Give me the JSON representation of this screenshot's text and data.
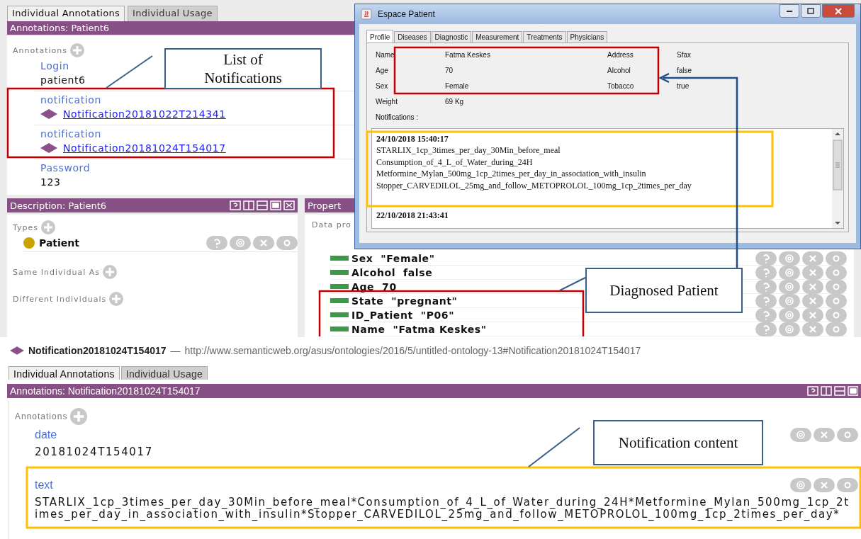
{
  "patient_annotations_panel": {
    "tabs": [
      {
        "label": "Individual Annotations",
        "selected": true
      },
      {
        "label": "Individual Usage",
        "selected": false
      }
    ],
    "header": "Annotations: Patient6",
    "section_label": "Annotations",
    "annotations": [
      {
        "property": "Login",
        "value": "patient6",
        "kind": "literal"
      },
      {
        "property": "notification",
        "value": "Notification20181022T214341",
        "kind": "individual"
      },
      {
        "property": "notification",
        "value": "Notification20181024T154017",
        "kind": "individual"
      },
      {
        "property": "Password",
        "value": "123",
        "kind": "literal"
      }
    ]
  },
  "description_panel": {
    "header": "Description: Patient6",
    "types_label": "Types",
    "types": [
      {
        "name": "Patient"
      }
    ],
    "sections": [
      "Same Individual As",
      "Different Individuals"
    ]
  },
  "property_panel": {
    "header": "Propert",
    "section_label": "Data pro",
    "assertions": [
      {
        "property": "Sex",
        "value": "\"Female\""
      },
      {
        "property": "Alcohol",
        "value": "false"
      },
      {
        "property": "Age",
        "value": "70"
      },
      {
        "property": "State",
        "value": "\"pregnant\""
      },
      {
        "property": "ID_Patient",
        "value": "\"P06\""
      },
      {
        "property": "Name",
        "value": "\"Fatma Keskes\""
      }
    ]
  },
  "patient_window": {
    "title": "Espace Patient",
    "tabs": [
      {
        "label": "Profile",
        "selected": true
      },
      {
        "label": "Diseases",
        "selected": false
      },
      {
        "label": "Diagnostic",
        "selected": false
      },
      {
        "label": "Measurement",
        "selected": false
      },
      {
        "label": "Treatments",
        "selected": false
      },
      {
        "label": "Physicians",
        "selected": false
      }
    ],
    "fields": [
      {
        "label": "Name",
        "value": "Fatma Keskes"
      },
      {
        "label": "Address",
        "value": "Sfax"
      },
      {
        "label": "Age",
        "value": "70"
      },
      {
        "label": "Alcohol",
        "value": "false"
      },
      {
        "label": "Sex",
        "value": "Female"
      },
      {
        "label": "Tobacco",
        "value": "true"
      },
      {
        "label": "Weight",
        "value": "69 Kg"
      }
    ],
    "notifications_label": "Notifications :",
    "notifications": [
      {
        "date": "24/10/2018 15:40:17",
        "lines": [
          "STARLIX_1cp_3times_per_day_30Min_before_meal",
          "Consumption_of_4_L_of_Water_during_24H",
          "Metformine_Mylan_500mg_1cp_2times_per_day_in_association_with_insulin",
          "Stopper_CARVEDILOL_25mg_and_follow_METOPROLOL_100mg_1cp_2times_per_day"
        ]
      },
      {
        "date": "22/10/2018 21:43:41"
      }
    ]
  },
  "entity_bar": {
    "name": "Notification20181024T154017",
    "separator": "—",
    "iri": "http://www.semanticweb.org/asus/ontologies/2016/5/untitled-ontology-13#Notification20181024T154017"
  },
  "notification_annotations_panel": {
    "tabs": [
      {
        "label": "Individual Annotations",
        "selected": true
      },
      {
        "label": "Individual Usage",
        "selected": false
      }
    ],
    "header": "Annotations: Notification20181024T154017",
    "section_label": "Annotations",
    "annotations": [
      {
        "property": "date",
        "value": "20181024T154017"
      },
      {
        "property": "text",
        "value": "STARLIX_1cp_3times_per_day_30Min_before_meal*Consumption_of_4_L_of_Water_during_24H*Metformine_Mylan_500mg_1cp_2times_per_day_in_association_with_insulin*Stopper_CARVEDILOL_25mg_and_follow_METOPROLOL_100mg_1cp_2times_per_day*"
      }
    ]
  },
  "callouts": [
    {
      "text": "List of Notifications"
    },
    {
      "text": "Diagnosed Patient"
    },
    {
      "text": "Notification content"
    }
  ]
}
